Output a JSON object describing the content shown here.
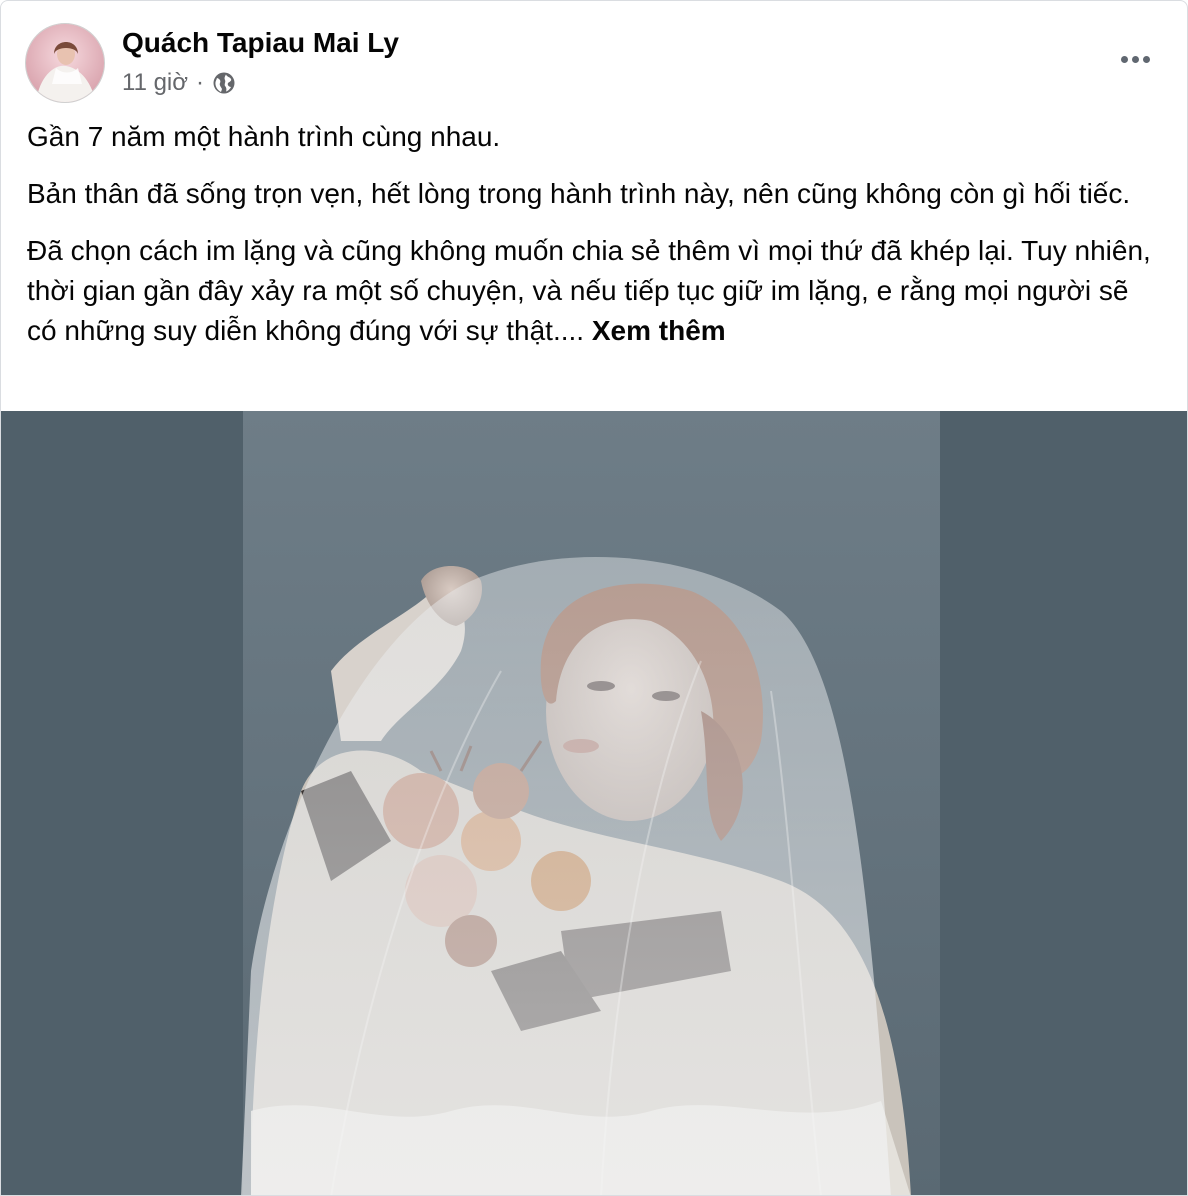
{
  "post": {
    "author": "Quách Tapiau Mai Ly",
    "time": "11 giờ",
    "separator": "·",
    "audience_icon": "globe-icon",
    "more_icon": "more-options-icon",
    "paragraphs": [
      "Gần 7 năm một hành trình cùng nhau.",
      "Bản thân đã sống trọn vẹn, hết lòng trong hành trình này, nên cũng không còn gì hối tiếc.",
      "Đã chọn cách im lặng và cũng không muốn chia sẻ thêm vì mọi thứ đã khép lại. Tuy nhiên, thời gian gần đây xảy ra một số chuyện, và nếu tiếp tục giữ im lặng, e rằng mọi người sẽ có những suy diễn không đúng với sự thật...."
    ],
    "see_more": "Xem thêm"
  },
  "colors": {
    "text": "#050505",
    "secondary_text": "#65676b",
    "photo_background": "#50606a",
    "photo_inner_background": "#6b7a84"
  }
}
